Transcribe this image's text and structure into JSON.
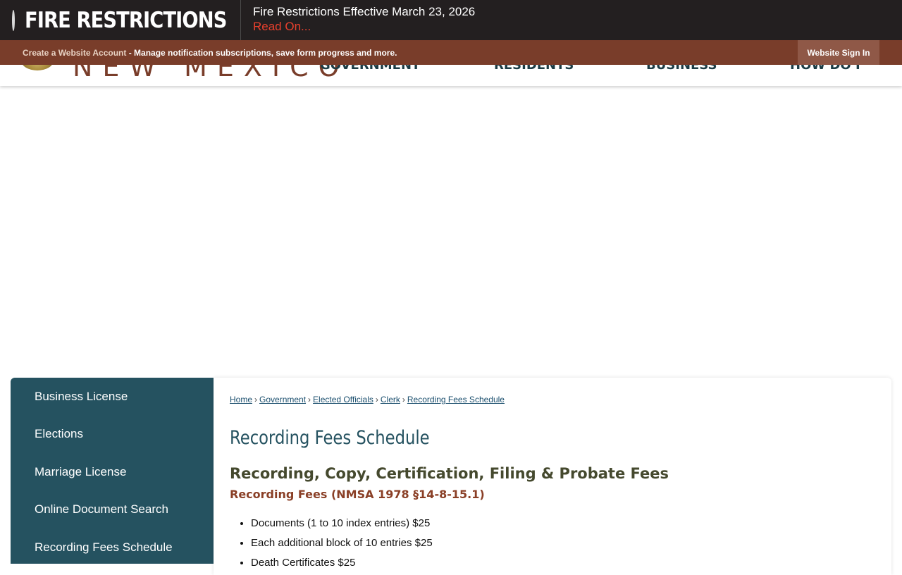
{
  "alert": {
    "title": "FIRE RESTRICTIONS",
    "message": "Fire Restrictions Effective March 23, 2026",
    "link": "Read On..."
  },
  "account_bar": {
    "create_link": "Create a Website Account",
    "description": " - Manage notification subscriptions, save form progress and more.",
    "sign_in": "Website Sign In"
  },
  "header": {
    "logo_text": "NEW MEXICO",
    "nav": [
      "GOVERNMENT",
      "RESIDENTS",
      "BUSINESS",
      "HOW DO I"
    ]
  },
  "sidebar": {
    "items": [
      "Business License",
      "Elections",
      "Marriage License",
      "Online Document Search",
      "Recording Fees Schedule"
    ]
  },
  "breadcrumb": {
    "items": [
      "Home",
      "Government",
      "Elected Officials",
      "Clerk",
      "Recording Fees Schedule"
    ],
    "separator": "›"
  },
  "content": {
    "title": "Recording Fees Schedule",
    "heading": "Recording, Copy, Certification, Filing & Probate Fees",
    "subheading": "Recording Fees (NMSA 1978 §14-8-15.1)",
    "fees": [
      "Documents (1 to 10 index entries) $25",
      "Each additional block of 10 entries $25",
      "Death Certificates $25"
    ]
  },
  "colors": {
    "alert_bg": "#231f20",
    "account_bar": "#793d2a",
    "sidebar": "#255260",
    "title": "#255260",
    "heading": "#45492e",
    "subheading": "#8a3f26"
  }
}
